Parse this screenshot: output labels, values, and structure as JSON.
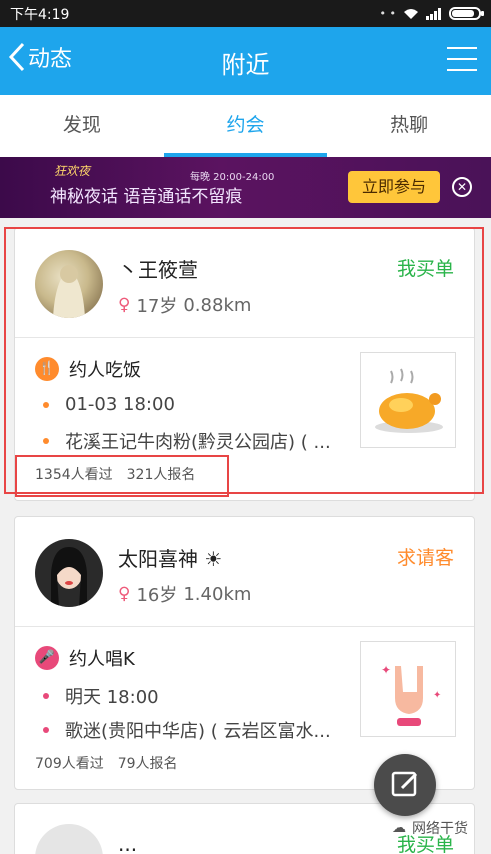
{
  "status": {
    "time": "下午4:19",
    "battery_level": 0.85
  },
  "header": {
    "back_label": "动态",
    "title": "附近"
  },
  "tabs": [
    {
      "label": "发现"
    },
    {
      "label": "约会"
    },
    {
      "label": "热聊"
    }
  ],
  "banner": {
    "logo": "狂欢夜",
    "tagline": "神秘夜话  语音通话不留痕",
    "hours": "每晚 20:00-24:00",
    "join_label": "立即参与"
  },
  "cards": [
    {
      "name": "丶王筱萱",
      "age": "17岁",
      "distance": "0.88km",
      "pay": "我买单",
      "pay_color": "#2ab44a",
      "category": "约人吃饭",
      "category_color": "#ff8b2d",
      "date": "01-03 18:00",
      "place": "花溪王记牛肉粉(黔灵公园店) ( ...",
      "views": "1354人看过",
      "signups": "321人报名"
    },
    {
      "name": "太阳喜神",
      "age": "16岁",
      "distance": "1.40km",
      "pay": "求请客",
      "pay_color": "#ff8b2d",
      "category": "约人唱K",
      "category_color": "#e8497a",
      "date": "明天 18:00",
      "place": "歌迷(贵阳中华店) ( 云岩区富水...",
      "views": "709人看过",
      "signups": "79人报名"
    },
    {
      "name": "...",
      "pay": "我买单",
      "pay_color": "#2ab44a"
    }
  ],
  "watermark": "网络干货"
}
